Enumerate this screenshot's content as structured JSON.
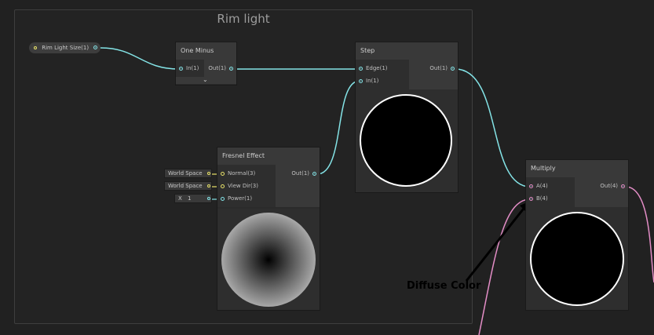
{
  "group": {
    "title": "Rim light"
  },
  "property_node": {
    "label": "Rim Light Size(1)"
  },
  "one_minus": {
    "title": "One Minus",
    "in": "In(1)",
    "out": "Out(1)"
  },
  "step": {
    "title": "Step",
    "in_edge": "Edge(1)",
    "in_in": "In(1)",
    "out": "Out(1)"
  },
  "fresnel": {
    "title": "Fresnel Effect",
    "in_normal": "Normal(3)",
    "in_view": "View Dir(3)",
    "in_power": "Power(1)",
    "out": "Out(1)",
    "normal_field": "World Space",
    "view_field": "World Space",
    "power_axis": "X",
    "power_value": "1"
  },
  "multiply": {
    "title": "Multiply",
    "in_a": "A(4)",
    "in_b": "B(4)",
    "out": "Out(4)"
  },
  "annotation": {
    "text": "Diffuse Color"
  },
  "colors": {
    "wire_float": "#84e4e7",
    "wire_vector": "#e38dc6",
    "wire_vec3": "#e8e26a",
    "background": "#212121"
  }
}
